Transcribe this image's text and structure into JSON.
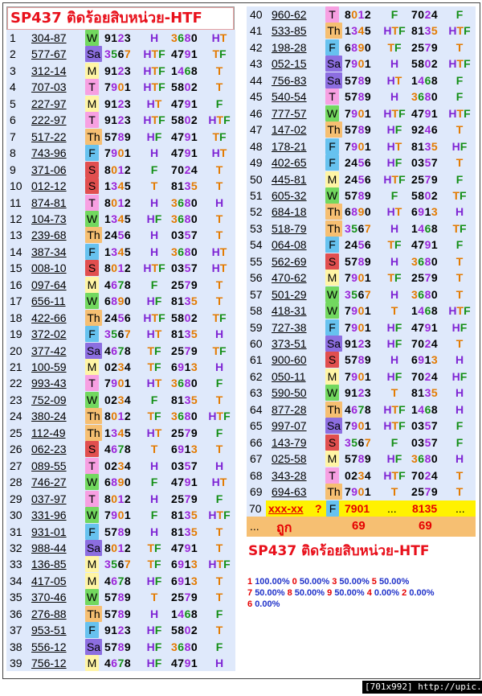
{
  "title": "SP437 ติดร้อยสิบหน่วย-HTF",
  "title2": "SP437 ติดร้อยสิบหน่วย-HTF",
  "day_colors": {
    "W": "#72d85f",
    "Sa": "#8c6ee0",
    "M": "#fff5a5",
    "T": "#f7a0e2",
    "Th": "#f6bf72",
    "F": "#67c2ef",
    "S": "#e14f4f"
  },
  "digit_colors": {
    "f": "#000000",
    "c": "#e37a00",
    "v": "#9b26d9",
    "g": "#148f16"
  },
  "word_colors": {
    "H": "#7f25d4",
    "HT": "#7f25d4",
    "HTF": "#7f25d4",
    "HF": "#7f25d4",
    "T": "#e37a00",
    "TF": "#e37a00",
    "F": "#148f16"
  },
  "left_rows": [
    {
      "n": "1",
      "code": "304-87",
      "day": "W",
      "d1": "9123",
      "w1": "H",
      "d2": "3680",
      "w2": "HT"
    },
    {
      "n": "2",
      "code": "577-67",
      "day": "Sa",
      "d1": "3567",
      "w1": "HTF",
      "d2": "4791",
      "w2": "TF"
    },
    {
      "n": "3",
      "code": "312-14",
      "day": "M",
      "d1": "9123",
      "w1": "HTF",
      "d2": "1468",
      "w2": "T"
    },
    {
      "n": "4",
      "code": "707-03",
      "day": "T",
      "d1": "7901",
      "w1": "HTF",
      "d2": "5802",
      "w2": "T"
    },
    {
      "n": "5",
      "code": "227-97",
      "day": "M",
      "d1": "9123",
      "w1": "HT",
      "d2": "4791",
      "w2": "F"
    },
    {
      "n": "6",
      "code": "222-97",
      "day": "T",
      "d1": "9123",
      "w1": "HTF",
      "d2": "5802",
      "w2": "HTF"
    },
    {
      "n": "7",
      "code": "517-22",
      "day": "Th",
      "d1": "5789",
      "w1": "HF",
      "d2": "4791",
      "w2": "TF"
    },
    {
      "n": "8",
      "code": "743-96",
      "day": "F",
      "d1": "7901",
      "w1": "H",
      "d2": "4791",
      "w2": "HT"
    },
    {
      "n": "9",
      "code": "371-06",
      "day": "S",
      "d1": "8012",
      "w1": "F",
      "d2": "7024",
      "w2": "T"
    },
    {
      "n": "10",
      "code": "012-12",
      "day": "S",
      "d1": "1345",
      "w1": "T",
      "d2": "8135",
      "w2": "T"
    },
    {
      "n": "11",
      "code": "874-81",
      "day": "T",
      "d1": "8012",
      "w1": "H",
      "d2": "3680",
      "w2": "H"
    },
    {
      "n": "12",
      "code": "104-73",
      "day": "W",
      "d1": "1345",
      "w1": "HF",
      "d2": "3680",
      "w2": "T"
    },
    {
      "n": "13",
      "code": "239-68",
      "day": "Th",
      "d1": "2456",
      "w1": "H",
      "d2": "0357",
      "w2": "T"
    },
    {
      "n": "14",
      "code": "387-34",
      "day": "F",
      "d1": "1345",
      "w1": "H",
      "d2": "3680",
      "w2": "HT"
    },
    {
      "n": "15",
      "code": "008-10",
      "day": "S",
      "d1": "8012",
      "w1": "HTF",
      "d2": "0357",
      "w2": "HT"
    },
    {
      "n": "16",
      "code": "097-64",
      "day": "M",
      "d1": "4678",
      "w1": "F",
      "d2": "2579",
      "w2": "T"
    },
    {
      "n": "17",
      "code": "656-11",
      "day": "W",
      "d1": "6890",
      "w1": "HF",
      "d2": "8135",
      "w2": "T"
    },
    {
      "n": "18",
      "code": "422-66",
      "day": "Th",
      "d1": "2456",
      "w1": "HTF",
      "d2": "5802",
      "w2": "TF"
    },
    {
      "n": "19",
      "code": "372-02",
      "day": "F",
      "d1": "3567",
      "w1": "HT",
      "d2": "8135",
      "w2": "H"
    },
    {
      "n": "20",
      "code": "377-42",
      "day": "Sa",
      "d1": "4678",
      "w1": "TF",
      "d2": "2579",
      "w2": "TF"
    },
    {
      "n": "21",
      "code": "100-59",
      "day": "M",
      "d1": "0234",
      "w1": "TF",
      "d2": "6913",
      "w2": "H"
    },
    {
      "n": "22",
      "code": "993-43",
      "day": "T",
      "d1": "7901",
      "w1": "HT",
      "d2": "3680",
      "w2": "F"
    },
    {
      "n": "23",
      "code": "752-09",
      "day": "W",
      "d1": "0234",
      "w1": "F",
      "d2": "8135",
      "w2": "T"
    },
    {
      "n": "24",
      "code": "380-24",
      "day": "Th",
      "d1": "8012",
      "w1": "TF",
      "d2": "3680",
      "w2": "HTF"
    },
    {
      "n": "25",
      "code": "112-49",
      "day": "Th",
      "d1": "1345",
      "w1": "HT",
      "d2": "2579",
      "w2": "F"
    },
    {
      "n": "26",
      "code": "062-23",
      "day": "S",
      "d1": "4678",
      "w1": "T",
      "d2": "6913",
      "w2": "T"
    },
    {
      "n": "27",
      "code": "089-55",
      "day": "T",
      "d1": "0234",
      "w1": "H",
      "d2": "0357",
      "w2": "H"
    },
    {
      "n": "28",
      "code": "746-27",
      "day": "W",
      "d1": "6890",
      "w1": "F",
      "d2": "4791",
      "w2": "HT"
    },
    {
      "n": "29",
      "code": "037-97",
      "day": "T",
      "d1": "8012",
      "w1": "H",
      "d2": "2579",
      "w2": "F"
    },
    {
      "n": "30",
      "code": "331-96",
      "day": "W",
      "d1": "7901",
      "w1": "F",
      "d2": "8135",
      "w2": "HTF"
    },
    {
      "n": "31",
      "code": "931-01",
      "day": "F",
      "d1": "5789",
      "w1": "H",
      "d2": "8135",
      "w2": "T"
    },
    {
      "n": "32",
      "code": "988-44",
      "day": "Sa",
      "d1": "8012",
      "w1": "TF",
      "d2": "4791",
      "w2": "T"
    },
    {
      "n": "33",
      "code": "136-85",
      "day": "M",
      "d1": "3567",
      "w1": "TF",
      "d2": "6913",
      "w2": "HTF"
    },
    {
      "n": "34",
      "code": "417-05",
      "day": "M",
      "d1": "4678",
      "w1": "HF",
      "d2": "6913",
      "w2": "T"
    },
    {
      "n": "35",
      "code": "370-46",
      "day": "W",
      "d1": "5789",
      "w1": "T",
      "d2": "2579",
      "w2": "T"
    },
    {
      "n": "36",
      "code": "276-88",
      "day": "Th",
      "d1": "5789",
      "w1": "H",
      "d2": "1468",
      "w2": "F"
    },
    {
      "n": "37",
      "code": "953-51",
      "day": "F",
      "d1": "9123",
      "w1": "HF",
      "d2": "5802",
      "w2": "T"
    },
    {
      "n": "38",
      "code": "556-12",
      "day": "Sa",
      "d1": "5789",
      "w1": "HF",
      "d2": "3680",
      "w2": "F"
    },
    {
      "n": "39",
      "code": "756-12",
      "day": "M",
      "d1": "4678",
      "w1": "HF",
      "d2": "4791",
      "w2": "H"
    }
  ],
  "right_rows": [
    {
      "n": "40",
      "code": "960-62",
      "day": "T",
      "d1": "8012",
      "w1": "F",
      "d2": "7024",
      "w2": "F"
    },
    {
      "n": "41",
      "code": "533-85",
      "day": "Th",
      "d1": "1345",
      "w1": "HTF",
      "d2": "8135",
      "w2": "HTF"
    },
    {
      "n": "42",
      "code": "198-28",
      "day": "F",
      "d1": "6890",
      "w1": "TF",
      "d2": "2579",
      "w2": "T"
    },
    {
      "n": "43",
      "code": "052-15",
      "day": "Sa",
      "d1": "7901",
      "w1": "H",
      "d2": "5802",
      "w2": "HTF"
    },
    {
      "n": "44",
      "code": "756-83",
      "day": "Sa",
      "d1": "5789",
      "w1": "HT",
      "d2": "1468",
      "w2": "F"
    },
    {
      "n": "45",
      "code": "540-54",
      "day": "T",
      "d1": "5789",
      "w1": "H",
      "d2": "3680",
      "w2": "F"
    },
    {
      "n": "46",
      "code": "777-57",
      "day": "W",
      "d1": "7901",
      "w1": "HTF",
      "d2": "4791",
      "w2": "HTF"
    },
    {
      "n": "47",
      "code": "147-02",
      "day": "Th",
      "d1": "5789",
      "w1": "HF",
      "d2": "9246",
      "w2": "T"
    },
    {
      "n": "48",
      "code": "178-21",
      "day": "F",
      "d1": "7901",
      "w1": "HT",
      "d2": "8135",
      "w2": "HF"
    },
    {
      "n": "49",
      "code": "402-65",
      "day": "F",
      "d1": "2456",
      "w1": "HF",
      "d2": "0357",
      "w2": "T"
    },
    {
      "n": "50",
      "code": "445-81",
      "day": "M",
      "d1": "2456",
      "w1": "HTF",
      "d2": "2579",
      "w2": "F"
    },
    {
      "n": "51",
      "code": "605-32",
      "day": "W",
      "d1": "5789",
      "w1": "F",
      "d2": "5802",
      "w2": "TF"
    },
    {
      "n": "52",
      "code": "684-18",
      "day": "Th",
      "d1": "6890",
      "w1": "HT",
      "d2": "6913",
      "w2": "H"
    },
    {
      "n": "53",
      "code": "518-79",
      "day": "Th",
      "d1": "3567",
      "w1": "H",
      "d2": "1468",
      "w2": "TF"
    },
    {
      "n": "54",
      "code": "064-08",
      "day": "F",
      "d1": "2456",
      "w1": "TF",
      "d2": "4791",
      "w2": "F"
    },
    {
      "n": "55",
      "code": "562-69",
      "day": "S",
      "d1": "5789",
      "w1": "H",
      "d2": "3680",
      "w2": "T"
    },
    {
      "n": "56",
      "code": "470-62",
      "day": "M",
      "d1": "7901",
      "w1": "TF",
      "d2": "2579",
      "w2": "T"
    },
    {
      "n": "57",
      "code": "501-29",
      "day": "W",
      "d1": "3567",
      "w1": "H",
      "d2": "3680",
      "w2": "T"
    },
    {
      "n": "58",
      "code": "418-31",
      "day": "W",
      "d1": "7901",
      "w1": "T",
      "d2": "1468",
      "w2": "HTF"
    },
    {
      "n": "59",
      "code": "727-38",
      "day": "F",
      "d1": "7901",
      "w1": "HF",
      "d2": "4791",
      "w2": "HF"
    },
    {
      "n": "60",
      "code": "373-51",
      "day": "Sa",
      "d1": "9123",
      "w1": "HF",
      "d2": "7024",
      "w2": "T"
    },
    {
      "n": "61",
      "code": "900-60",
      "day": "S",
      "d1": "5789",
      "w1": "H",
      "d2": "6913",
      "w2": "H"
    },
    {
      "n": "62",
      "code": "050-11",
      "day": "M",
      "d1": "7901",
      "w1": "HF",
      "d2": "7024",
      "w2": "HF"
    },
    {
      "n": "63",
      "code": "590-50",
      "day": "W",
      "d1": "9123",
      "w1": "T",
      "d2": "8135",
      "w2": "H"
    },
    {
      "n": "64",
      "code": "877-28",
      "day": "Th",
      "d1": "4678",
      "w1": "HTF",
      "d2": "1468",
      "w2": "H"
    },
    {
      "n": "65",
      "code": "997-07",
      "day": "Sa",
      "d1": "7901",
      "w1": "HTF",
      "d2": "0357",
      "w2": "F"
    },
    {
      "n": "66",
      "code": "143-79",
      "day": "S",
      "d1": "3567",
      "w1": "F",
      "d2": "0357",
      "w2": "F"
    },
    {
      "n": "67",
      "code": "025-58",
      "day": "M",
      "d1": "5789",
      "w1": "HF",
      "d2": "3680",
      "w2": "H"
    },
    {
      "n": "68",
      "code": "343-28",
      "day": "T",
      "d1": "0234",
      "w1": "HTF",
      "d2": "7024",
      "w2": "T"
    },
    {
      "n": "69",
      "code": "694-63",
      "day": "Th",
      "d1": "7901",
      "w1": "T",
      "d2": "2579",
      "w2": "T"
    }
  ],
  "row70": {
    "n": "70",
    "code": "xxx-xx",
    "q": "?",
    "day": "F",
    "d1": "7901",
    "w1": "...",
    "d2": "8135",
    "w2": "..."
  },
  "summary": {
    "n": "...",
    "label": "ถูก",
    "v1": "69",
    "v2": "69"
  },
  "stats": [
    {
      "k": "1",
      "v": "100.00%"
    },
    {
      "k": "0",
      "v": "50.00%"
    },
    {
      "k": "3",
      "v": "50.00%"
    },
    {
      "k": "5",
      "v": "50.00%"
    },
    {
      "k": "7",
      "v": "50.00%"
    },
    {
      "k": "8",
      "v": "50.00%"
    },
    {
      "k": "9",
      "v": "50.00%"
    },
    {
      "k": "4",
      "v": "0.00%"
    },
    {
      "k": "2",
      "v": "0.00%"
    },
    {
      "k": "6",
      "v": "0.00%"
    }
  ],
  "footer": "[701x992] http://upic.me/"
}
